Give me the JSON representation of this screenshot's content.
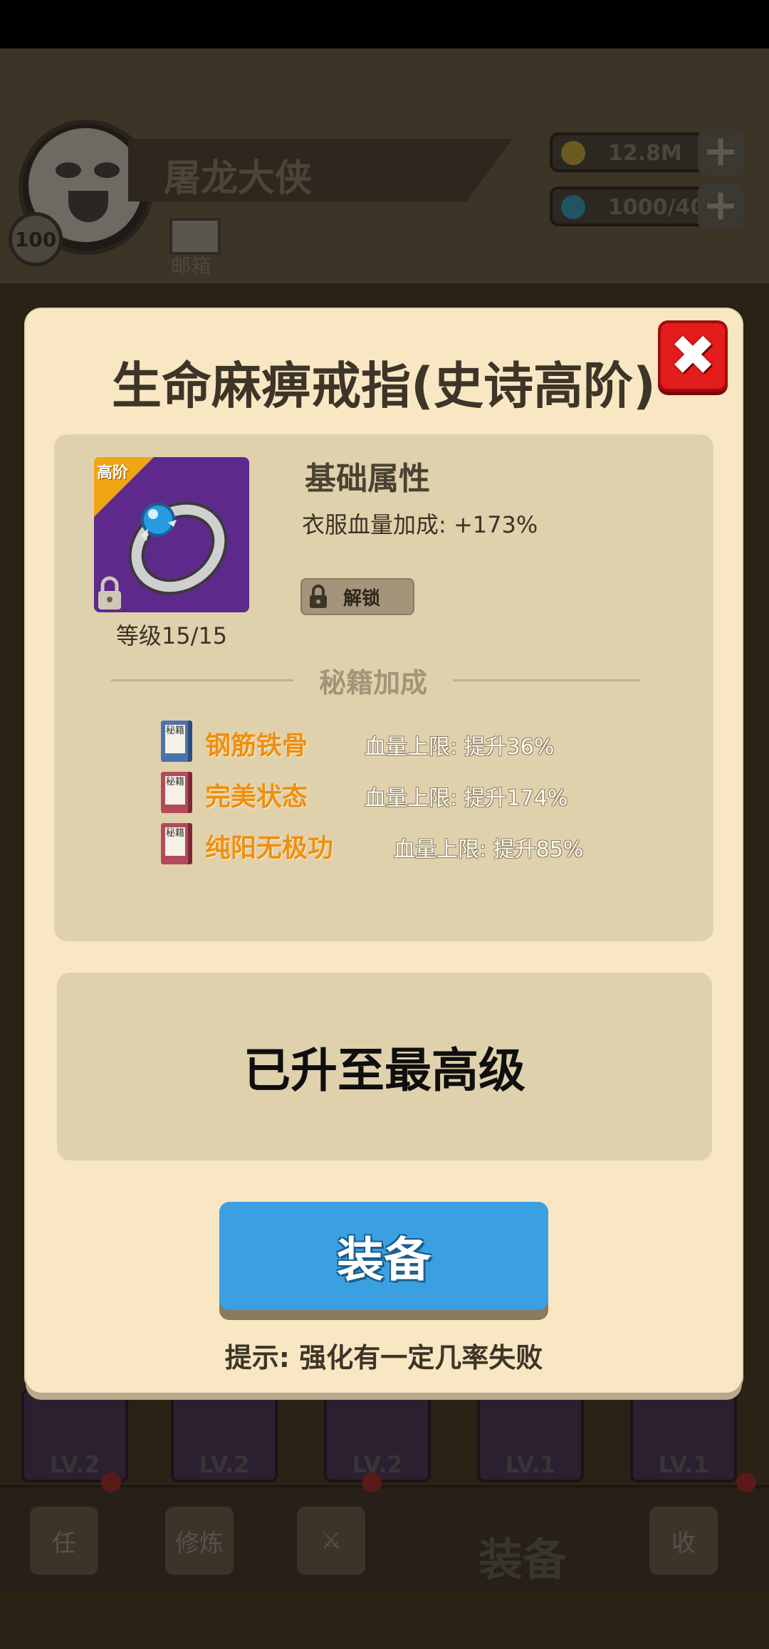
{
  "player": {
    "name": "屠龙大侠",
    "level": "100",
    "mail_label": "邮箱"
  },
  "currency": {
    "gold": "12.8M",
    "gems": "1000/40"
  },
  "bottom_slots": [
    {
      "label": "LV.2"
    },
    {
      "label": "LV.2"
    },
    {
      "label": "LV.2"
    },
    {
      "label": "LV.1"
    },
    {
      "label": "LV.1"
    }
  ],
  "nav": {
    "tasks_icon_text": "任",
    "train_icon_text": "修炼",
    "collect_icon_text": "收",
    "equip_label": "装备"
  },
  "modal": {
    "title": "生命麻痹戒指(史诗高阶)",
    "item": {
      "tier_tag": "高阶",
      "level": "等级15/15"
    },
    "base_attr": {
      "title": "基础属性",
      "value": "衣服血量加成: +173%"
    },
    "unlock_label": "解锁",
    "secret_title": "秘籍加成",
    "secrets": [
      {
        "book_text": "秘籍",
        "name": "钢筋铁骨",
        "effect": "血量上限: 提升36%",
        "book_color": "#4a74b0"
      },
      {
        "book_text": "秘籍",
        "name": "完美状态",
        "effect": "血量上限: 提升174%",
        "book_color": "#b24a5a"
      },
      {
        "book_text": "秘籍",
        "name": "纯阳无极功",
        "effect": "血量上限: 提升85%",
        "book_color": "#b24a5a"
      }
    ],
    "max_level_text": "已升至最高级",
    "equip_button": "装备",
    "hint": "提示: 强化有一定几率失败"
  },
  "colors": {
    "modal_bg": "#f9e7c4",
    "panel_bg": "#e0d1ad",
    "accent_orange": "#ee8f12",
    "equip_blue": "#3aa0e2",
    "close_red": "#e31c1c"
  }
}
